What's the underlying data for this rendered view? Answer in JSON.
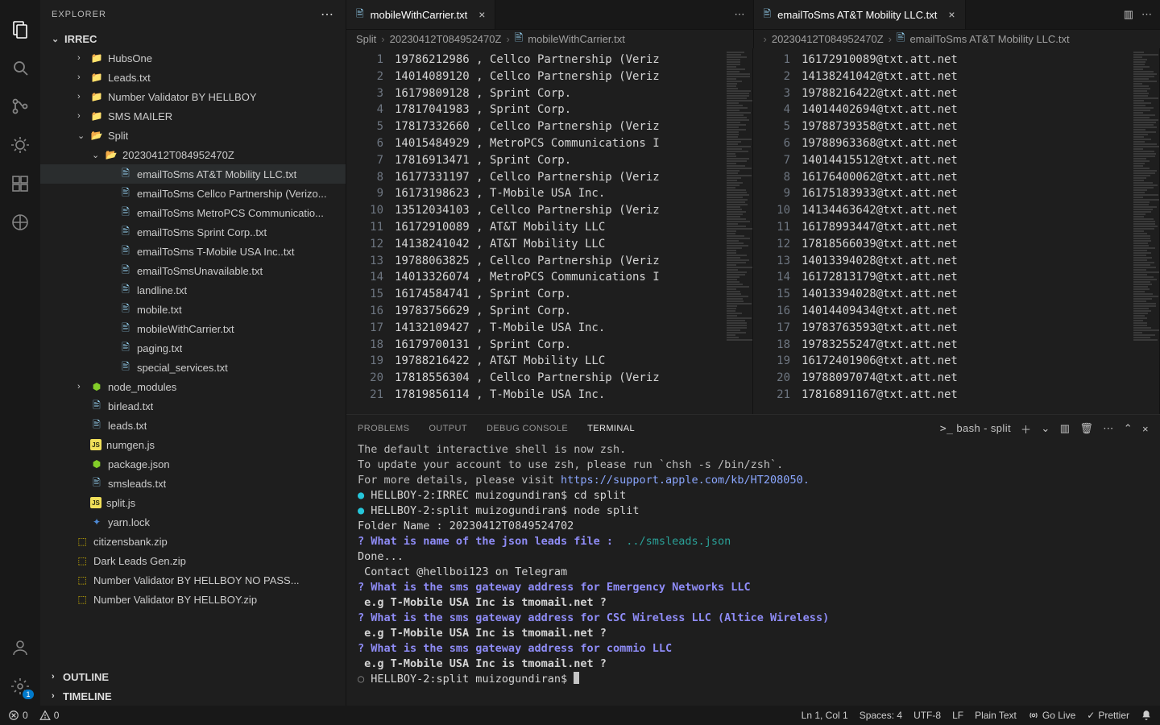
{
  "explorer": {
    "title": "EXPLORER",
    "root": "IRREC",
    "tree": [
      {
        "indent": 1,
        "kind": "folder",
        "label": "HubsOne",
        "chev": "›"
      },
      {
        "indent": 1,
        "kind": "folder",
        "label": "Leads.txt",
        "chev": "›"
      },
      {
        "indent": 1,
        "kind": "folder",
        "label": "Number Validator BY HELLBOY",
        "chev": "›"
      },
      {
        "indent": 1,
        "kind": "folder",
        "label": "SMS MAILER",
        "chev": "›"
      },
      {
        "indent": 1,
        "kind": "folder-open",
        "label": "Split",
        "chev": "⌄"
      },
      {
        "indent": 2,
        "kind": "folder-open",
        "label": "20230412T084952470Z",
        "chev": "⌄"
      },
      {
        "indent": 3,
        "kind": "file",
        "label": "emailToSms AT&T Mobility LLC.txt",
        "selected": true
      },
      {
        "indent": 3,
        "kind": "file",
        "label": "emailToSms Cellco Partnership (Verizo..."
      },
      {
        "indent": 3,
        "kind": "file",
        "label": "emailToSms MetroPCS Communicatio..."
      },
      {
        "indent": 3,
        "kind": "file",
        "label": "emailToSms Sprint Corp..txt"
      },
      {
        "indent": 3,
        "kind": "file",
        "label": "emailToSms T-Mobile USA Inc..txt"
      },
      {
        "indent": 3,
        "kind": "file",
        "label": "emailToSmsUnavailable.txt"
      },
      {
        "indent": 3,
        "kind": "file",
        "label": "landline.txt"
      },
      {
        "indent": 3,
        "kind": "file",
        "label": "mobile.txt"
      },
      {
        "indent": 3,
        "kind": "file",
        "label": "mobileWithCarrier.txt"
      },
      {
        "indent": 3,
        "kind": "file",
        "label": "paging.txt"
      },
      {
        "indent": 3,
        "kind": "file",
        "label": "special_services.txt"
      },
      {
        "indent": 1,
        "kind": "node",
        "label": "node_modules",
        "chev": "›"
      },
      {
        "indent": 1,
        "kind": "file",
        "label": "birlead.txt"
      },
      {
        "indent": 1,
        "kind": "file",
        "label": "leads.txt"
      },
      {
        "indent": 1,
        "kind": "js",
        "label": "numgen.js"
      },
      {
        "indent": 1,
        "kind": "node",
        "label": "package.json"
      },
      {
        "indent": 1,
        "kind": "file",
        "label": "smsleads.txt"
      },
      {
        "indent": 1,
        "kind": "js",
        "label": "split.js"
      },
      {
        "indent": 1,
        "kind": "yarn",
        "label": "yarn.lock"
      },
      {
        "indent": 0,
        "kind": "zip",
        "label": "citizensbank.zip"
      },
      {
        "indent": 0,
        "kind": "zip",
        "label": "Dark Leads Gen.zip"
      },
      {
        "indent": 0,
        "kind": "zip",
        "label": "Number Validator BY HELLBOY NO PASS..."
      },
      {
        "indent": 0,
        "kind": "zip",
        "label": "Number Validator BY HELLBOY.zip"
      }
    ],
    "panels": {
      "outline": "OUTLINE",
      "timeline": "TIMELINE"
    }
  },
  "editors": {
    "left": {
      "tab_label": "mobileWithCarrier.txt",
      "breadcrumbs": [
        "Split",
        "20230412T084952470Z",
        "mobileWithCarrier.txt"
      ],
      "lines": [
        "19786212986 , Cellco Partnership (Veriz",
        "14014089120 , Cellco Partnership (Veriz",
        "16179809128 , Sprint Corp.",
        "17817041983 , Sprint Corp.",
        "17817332660 , Cellco Partnership (Veriz",
        "14015484929 , MetroPCS Communications I",
        "17816913471 , Sprint Corp.",
        "16177331197 , Cellco Partnership (Veriz",
        "16173198623 , T-Mobile USA Inc.",
        "13512034103 , Cellco Partnership (Veriz",
        "16172910089 , AT&T Mobility LLC",
        "14138241042 , AT&T Mobility LLC",
        "19788063825 , Cellco Partnership (Veriz",
        "14013326074 , MetroPCS Communications I",
        "16174584741 , Sprint Corp.",
        "19783756629 , Sprint Corp.",
        "14132109427 , T-Mobile USA Inc.",
        "16179700131 , Sprint Corp.",
        "19788216422 , AT&T Mobility LLC",
        "17818556304 , Cellco Partnership (Veriz",
        "17819856114 , T-Mobile USA Inc."
      ]
    },
    "right": {
      "tab_label": "emailToSms AT&T Mobility LLC.txt",
      "breadcrumbs": [
        "20230412T084952470Z",
        "emailToSms AT&T Mobility LLC.txt"
      ],
      "lines": [
        "16172910089@txt.att.net",
        "14138241042@txt.att.net",
        "19788216422@txt.att.net",
        "14014402694@txt.att.net",
        "19788739358@txt.att.net",
        "19788963368@txt.att.net",
        "14014415512@txt.att.net",
        "16176400062@txt.att.net",
        "16175183933@txt.att.net",
        "14134463642@txt.att.net",
        "16178993447@txt.att.net",
        "17818566039@txt.att.net",
        "14013394028@txt.att.net",
        "16172813179@txt.att.net",
        "14013394028@txt.att.net",
        "14014409434@txt.att.net",
        "19783763593@txt.att.net",
        "19783255247@txt.att.net",
        "16172401906@txt.att.net",
        "19788097074@txt.att.net",
        "17816891167@txt.att.net"
      ]
    }
  },
  "panel": {
    "tabs": {
      "problems": "PROBLEMS",
      "output": "OUTPUT",
      "debug": "DEBUG CONSOLE",
      "terminal": "TERMINAL"
    },
    "shell_label": "bash - split",
    "terminal": [
      {
        "t": "dim",
        "text": "The default interactive shell is now zsh."
      },
      {
        "t": "dim",
        "text": "To update your account to use zsh, please run `chsh -s /bin/zsh`."
      },
      {
        "t": "url",
        "text": "For more details, please visit https://support.apple.com/kb/HT208050."
      },
      {
        "t": "prompt",
        "text": "● HELLBOY-2:IRREC muizogundiran$ cd split"
      },
      {
        "t": "prompt",
        "text": "● HELLBOY-2:split muizogundiran$ node split"
      },
      {
        "t": "plain",
        "text": "Folder Name : 20230412T0849524702"
      },
      {
        "t": "qa",
        "q": "? What is name of the json leads file :  ",
        "a": "../smsleads.json"
      },
      {
        "t": "plain",
        "text": "Done..."
      },
      {
        "t": "plain",
        "text": " Contact @hellboi123 on Telegram"
      },
      {
        "t": "q",
        "text": "? What is the sms gateway address for Emergency Networks LLC"
      },
      {
        "t": "bold",
        "text": " e.g T-Mobile USA Inc is tmomail.net ?"
      },
      {
        "t": "q",
        "text": "? What is the sms gateway address for CSC Wireless LLC (Altice Wireless)"
      },
      {
        "t": "bold",
        "text": " e.g T-Mobile USA Inc is tmomail.net ?"
      },
      {
        "t": "q",
        "text": "? What is the sms gateway address for commio LLC"
      },
      {
        "t": "bold",
        "text": " e.g T-Mobile USA Inc is tmomail.net ?"
      },
      {
        "t": "prompt2",
        "text": "○ HELLBOY-2:split muizogundiran$ "
      }
    ]
  },
  "status": {
    "errors": "0",
    "warnings": "0",
    "ln_col": "Ln 1, Col 1",
    "spaces": "Spaces: 4",
    "encoding": "UTF-8",
    "eol": "LF",
    "lang": "Plain Text",
    "golive": "Go Live",
    "prettier": "Prettier"
  }
}
